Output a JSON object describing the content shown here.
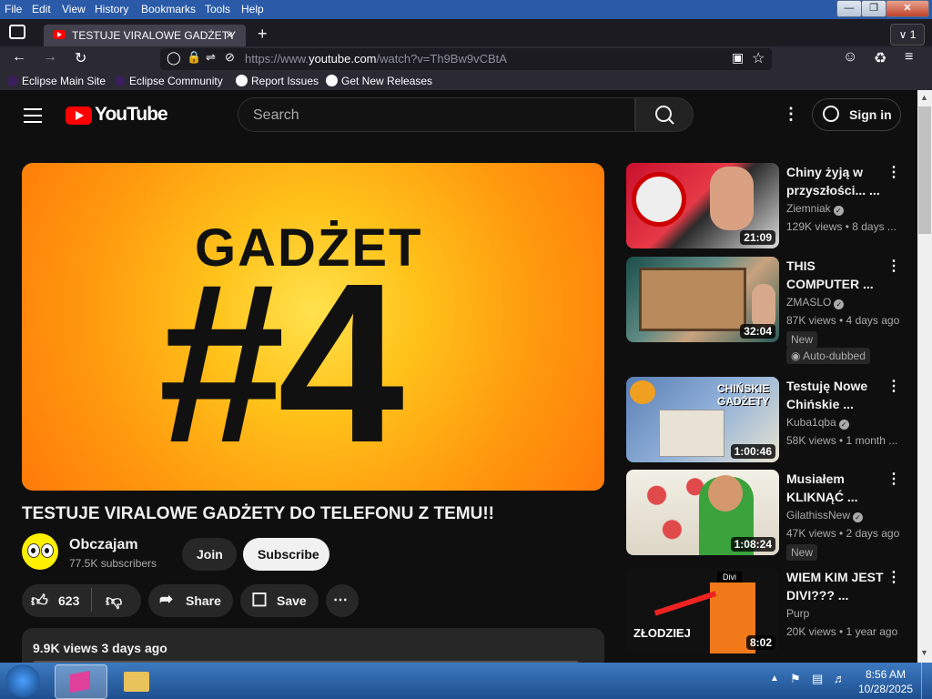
{
  "menubar": {
    "items": [
      "File",
      "Edit",
      "View",
      "History",
      "Bookmarks",
      "Tools",
      "Help"
    ]
  },
  "browser": {
    "tab_title": "TESTUJE VIRALOWE GADŻETY D",
    "tabs_count": "1",
    "url_prefix": "https://www.",
    "url_domain": "youtube.com",
    "url_path": "/watch?v=Th9Bw9vCBtA"
  },
  "bookmarks": [
    "Eclipse Main Site",
    "Eclipse Community",
    "Report Issues",
    "Get New Releases"
  ],
  "youtube": {
    "logo_text": "YouTube",
    "search_placeholder": "Search",
    "signin_label": "Sign in",
    "thumbnail_line1": "GADŻET",
    "thumbnail_line2": "#4",
    "video_title": "TESTUJE VIRALOWE GADŻETY DO TELEFONU Z TEMU!!",
    "channel_name": "Obczajam",
    "channel_subs": "77.5K subscribers",
    "join_label": "Join",
    "subscribe_label": "Subscribe",
    "like_count": "623",
    "share_label": "Share",
    "save_label": "Save",
    "views_date": "9.9K views  3 days ago"
  },
  "recommendations": [
    {
      "title": "Chiny żyją w przyszłości... ...",
      "channel": "Ziemniak",
      "meta": "129K views • 8 days ...",
      "duration": "21:09",
      "badges": []
    },
    {
      "title": "THIS COMPUTER ...",
      "channel": "ZMASLO",
      "meta": "87K views • 4 days ago",
      "duration": "32:04",
      "badges": [
        "New",
        "Auto-dubbed"
      ]
    },
    {
      "title": "Testuję Nowe Chińskie ...",
      "channel": "Kuba1qba",
      "meta": "58K views • 1 month ...",
      "duration": "1:00:46",
      "badges": []
    },
    {
      "title": "Musiałem KLIKNĄĆ ...",
      "channel": "GilathissNew",
      "meta": "47K views • 2 days ago",
      "duration": "1:08:24",
      "badges": [
        "New"
      ]
    },
    {
      "title": "WIEM KIM JEST DIVI??? ...",
      "channel": "Purp",
      "meta": "20K views • 1 year ago",
      "duration": "8:02",
      "badges": []
    }
  ],
  "rec_thumb_text": {
    "r3_line1": "CHIŃSKIE",
    "r3_line2": "GADŻETY",
    "r5_label": "Divi",
    "r5_text": "ZŁODZIEJ"
  },
  "taskbar": {
    "time": "8:56 AM",
    "date": "10/28/2025"
  },
  "colors": {
    "yt_red": "#ff0000",
    "yt_bg": "#0f0f0f",
    "taskbar": "#1e4f8f"
  }
}
